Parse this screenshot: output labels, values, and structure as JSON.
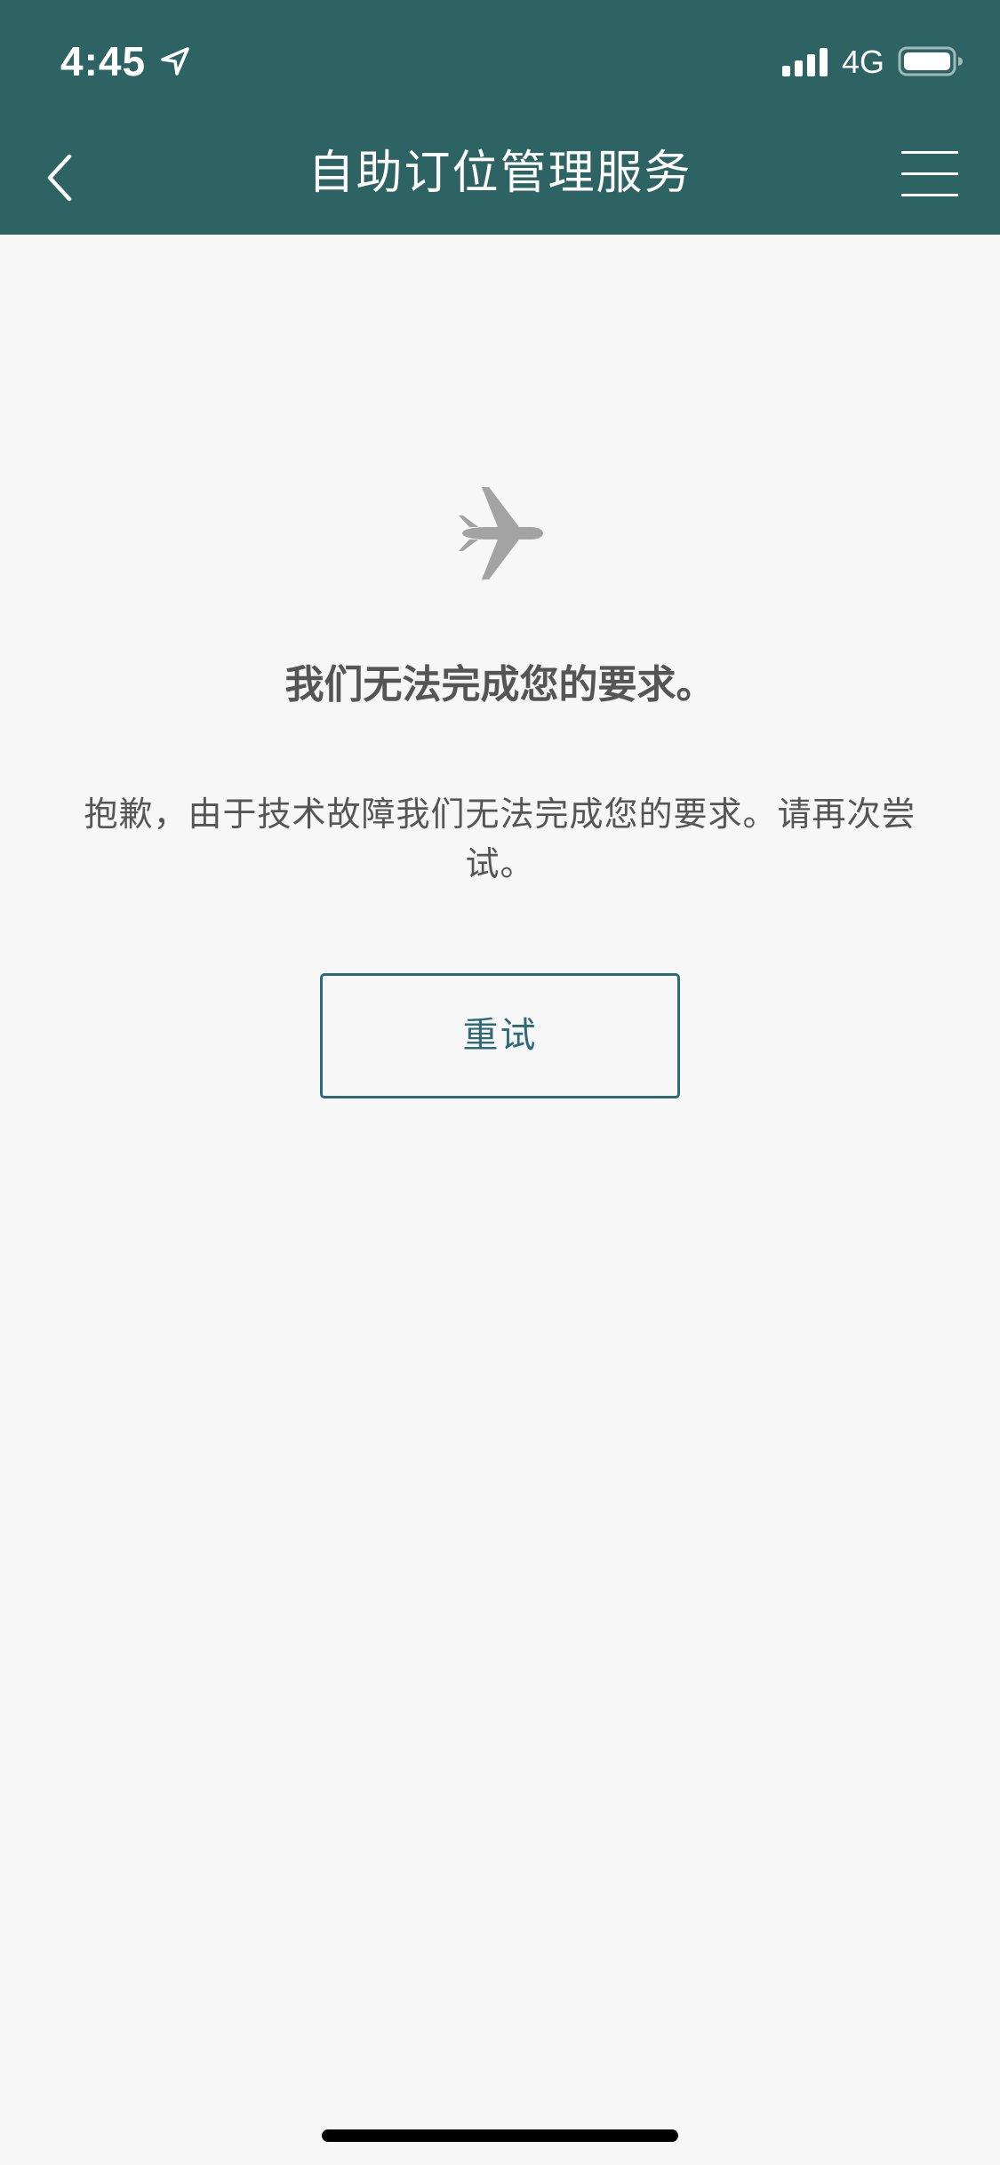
{
  "status_bar": {
    "time": "4:45",
    "network": "4G",
    "icons": [
      "location-arrow-icon",
      "signal-bars-icon",
      "battery-icon"
    ]
  },
  "nav": {
    "title": "自助订位管理服务",
    "back_icon": "chevron-left-icon",
    "menu_icon": "hamburger-menu-icon"
  },
  "error": {
    "icon": "airplane-icon",
    "title": "我们无法完成您的要求。",
    "message": "抱歉，由于技术故障我们无法完成您的要求。请再次尝试。",
    "retry_label": "重试"
  },
  "colors": {
    "header_bg": "#2d6363",
    "page_bg": "#f7f7f7",
    "text_gray": "#555555",
    "accent": "#2c6a7a",
    "icon_gray": "#a3a3a3"
  }
}
